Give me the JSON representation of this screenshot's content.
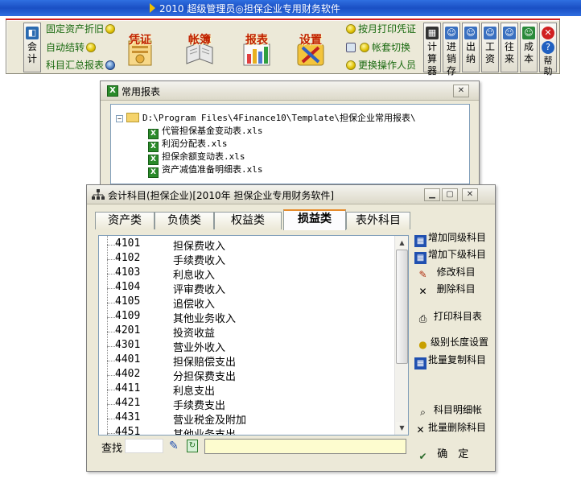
{
  "app": {
    "title": "2010  超级管理员◎担保企业专用财务软件"
  },
  "toolbar": {
    "kuaiji_label": "会计",
    "links_left": [
      "固定资产折旧",
      "自动结转",
      "科目汇总报表"
    ],
    "big": [
      {
        "label": "凭证",
        "icon": "voucher-icon"
      },
      {
        "label": "帐簿",
        "icon": "ledger-icon"
      },
      {
        "label": "报表",
        "icon": "report-icon"
      },
      {
        "label": "设置",
        "icon": "settings-icon"
      }
    ],
    "links_right": [
      "按月打印凭证",
      "帐套切换",
      "更换操作人员"
    ],
    "right_buttons": [
      "计算器",
      "进销存",
      "出纳",
      "工资",
      "往来",
      "成本",
      "帮助"
    ]
  },
  "report_window": {
    "title": "常用报表",
    "root_path": "D:\\Program Files\\4Finance10\\Template\\担保企业常用报表\\",
    "files": [
      "代管担保基金变动表.xls",
      "利润分配表.xls",
      "担保余额变动表.xls",
      "资产减值准备明细表.xls"
    ],
    "expander": "−"
  },
  "account_window": {
    "title": "会计科目(担保企业)[2010年 担保企业专用财务软件]",
    "tabs": [
      "资产类",
      "负债类",
      "权益类",
      "损益类",
      "表外科目"
    ],
    "active_tab": "损益类",
    "accounts": [
      {
        "code": "4101",
        "name": "担保费收入"
      },
      {
        "code": "4102",
        "name": "手续费收入"
      },
      {
        "code": "4103",
        "name": "利息收入"
      },
      {
        "code": "4104",
        "name": "评审费收入"
      },
      {
        "code": "4105",
        "name": "追偿收入"
      },
      {
        "code": "4109",
        "name": "其他业务收入"
      },
      {
        "code": "4201",
        "name": "投资收益"
      },
      {
        "code": "4301",
        "name": "营业外收入"
      },
      {
        "code": "4401",
        "name": "担保赔偿支出"
      },
      {
        "code": "4402",
        "name": "分担保费支出"
      },
      {
        "code": "4411",
        "name": "利息支出"
      },
      {
        "code": "4421",
        "name": "手续费支出"
      },
      {
        "code": "4431",
        "name": "营业税金及附加"
      },
      {
        "code": "4451",
        "name": "其他业务支出"
      }
    ],
    "actions": [
      {
        "label": "增加同级科目",
        "icon": "add-sibling-icon"
      },
      {
        "label": "增加下级科目",
        "icon": "add-child-icon"
      },
      {
        "label": "修改科目",
        "icon": "edit-icon"
      },
      {
        "label": "删除科目",
        "icon": "delete-icon"
      },
      {
        "label": "打印科目表",
        "icon": "printer-icon"
      },
      {
        "label": "级别长度设置",
        "icon": "bulb-icon"
      },
      {
        "label": "批量复制科目",
        "icon": "batch-copy-icon"
      },
      {
        "label": "科目明细帐",
        "icon": "magnifier-icon"
      },
      {
        "label": "批量删除科目",
        "icon": "batch-delete-icon"
      },
      {
        "label": "确　定",
        "icon": "confirm-icon"
      }
    ],
    "find_label": "查找",
    "find_value": ""
  }
}
